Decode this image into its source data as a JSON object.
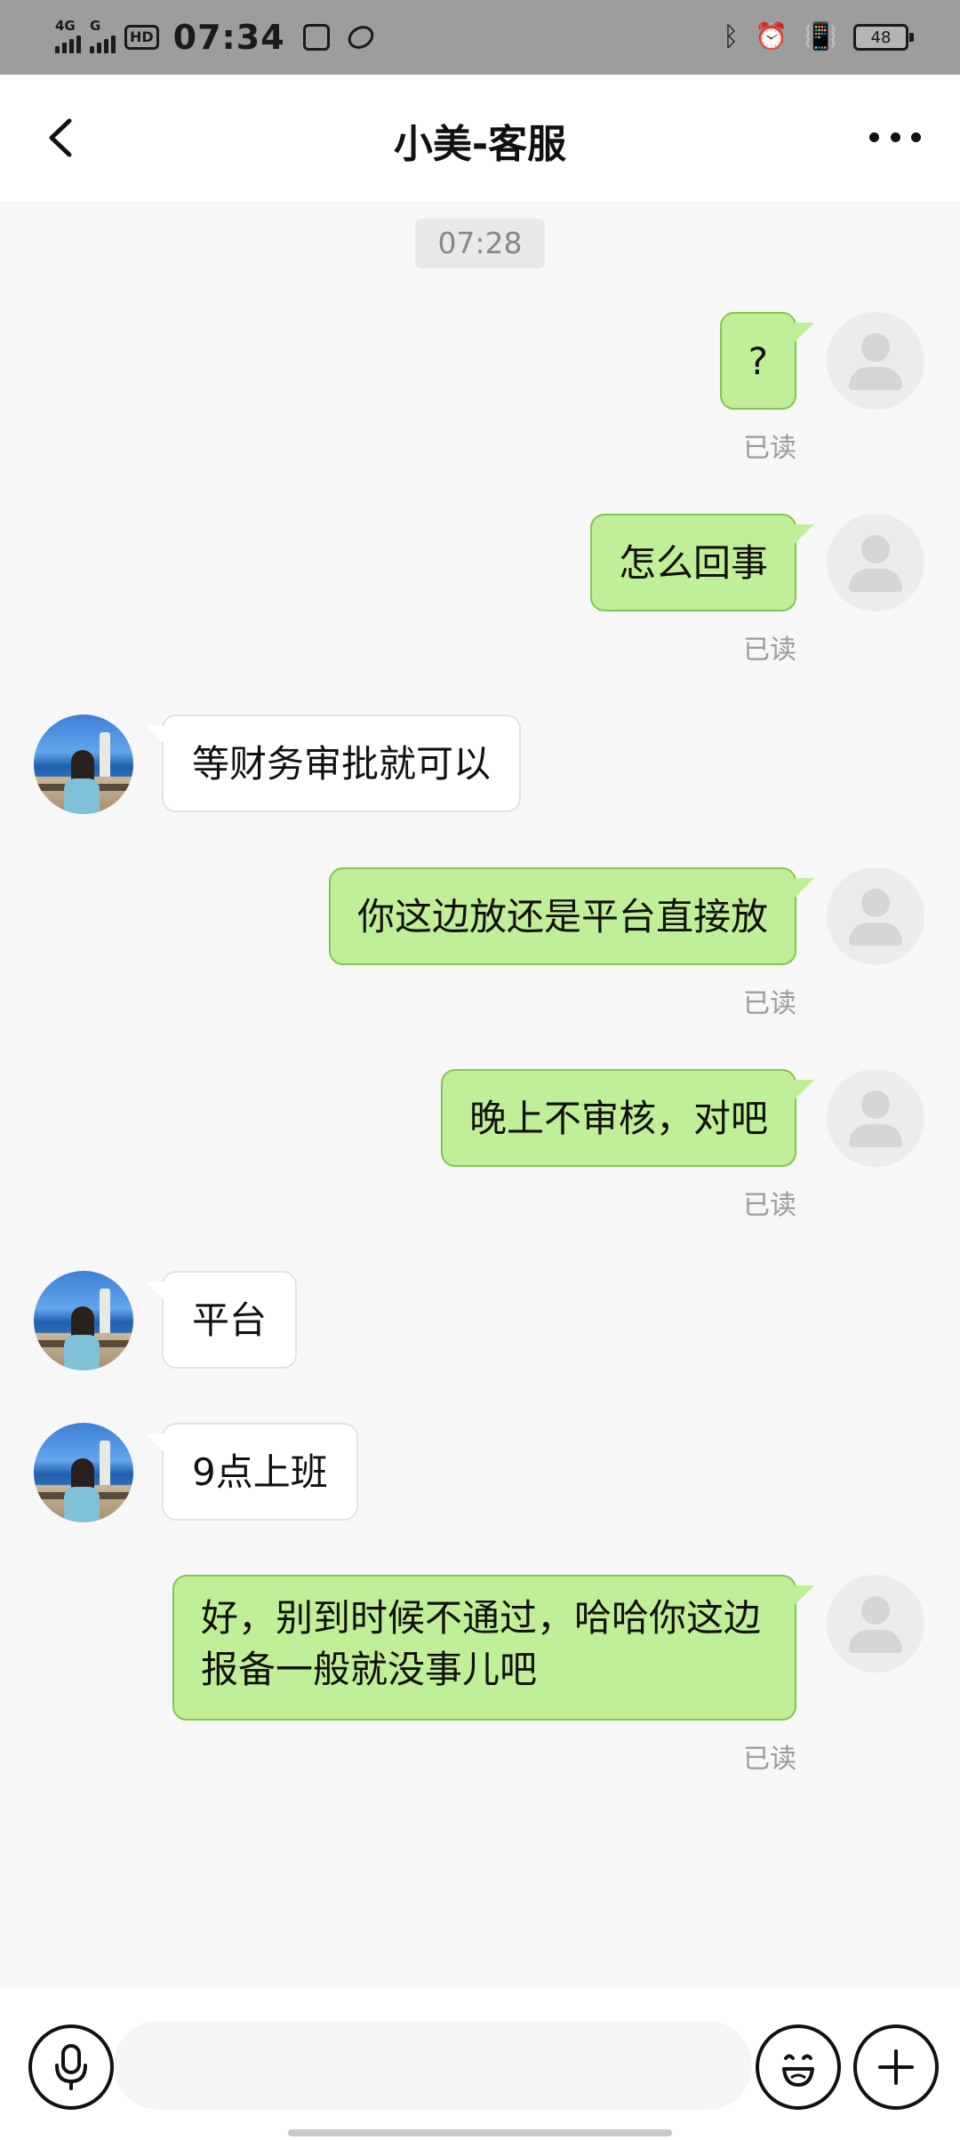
{
  "status_bar": {
    "network_1": "4G",
    "network_2": "G",
    "hd_badge": "HD",
    "time": "07:34",
    "battery": "48"
  },
  "header": {
    "title": "小美-客服"
  },
  "chat": {
    "timestamp": "07:28",
    "read_label": "已读",
    "messages": [
      {
        "from": "me",
        "text": "?"
      },
      {
        "from": "me",
        "text": "怎么回事"
      },
      {
        "from": "other",
        "text": "等财务审批就可以"
      },
      {
        "from": "me",
        "text": "你这边放还是平台直接放"
      },
      {
        "from": "me",
        "text": "晚上不审核，对吧"
      },
      {
        "from": "other",
        "text": "平台"
      },
      {
        "from": "other",
        "text": "9点上班"
      },
      {
        "from": "me",
        "text": "好，别到时候不通过，哈哈你这边报备一般就没事儿吧"
      }
    ]
  },
  "input": {
    "value": "",
    "placeholder": ""
  },
  "icons": {
    "back": "back-arrow-icon",
    "more": "more-dots-icon",
    "mic": "microphone-icon",
    "emoji": "emoji-icon",
    "plus": "plus-icon"
  },
  "colors": {
    "my_bubble": "#c1ef98",
    "other_bubble": "#ffffff",
    "status_bar": "#9d9d9d"
  }
}
